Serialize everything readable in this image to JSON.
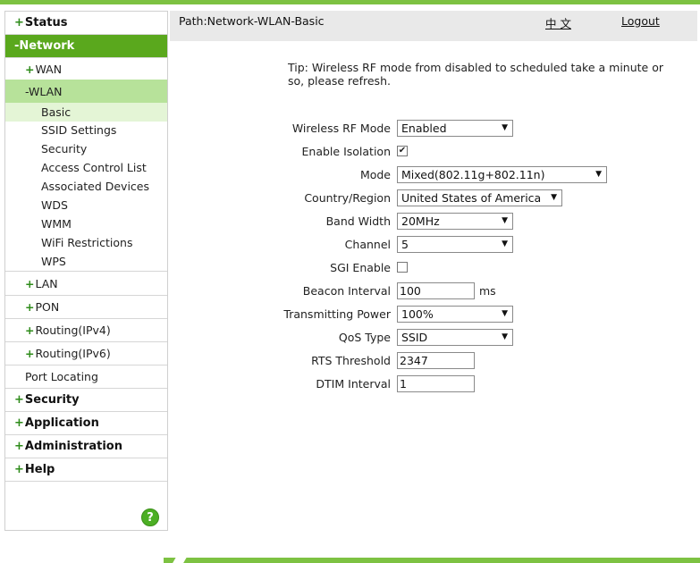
{
  "sidebar": {
    "status": "Status",
    "network": "-Network",
    "wan": "WAN",
    "wlan": "-WLAN",
    "wlan_items": [
      "Basic",
      "SSID Settings",
      "Security",
      "Access Control List",
      "Associated Devices",
      "WDS",
      "WMM",
      "WiFi Restrictions",
      "WPS"
    ],
    "lan": "LAN",
    "pon": "PON",
    "routing_ipv4": "Routing(IPv4)",
    "routing_ipv6": "Routing(IPv6)",
    "port_locating": "Port Locating",
    "security": "Security",
    "application": "Application",
    "administration": "Administration",
    "help": "Help",
    "help_icon": "?"
  },
  "header": {
    "breadcrumb": "Path:Network-WLAN-Basic",
    "language": "中 文",
    "logout": "Logout"
  },
  "tip": "Tip: Wireless RF mode from disabled to scheduled take a minute or so, please refresh.",
  "form": {
    "rf_mode": {
      "label": "Wireless RF Mode",
      "value": "Enabled"
    },
    "isolation": {
      "label": "Enable Isolation",
      "checked": true
    },
    "mode": {
      "label": "Mode",
      "value": "Mixed(802.11g+802.11n)"
    },
    "country": {
      "label": "Country/Region",
      "value": "United States of America"
    },
    "bandwidth": {
      "label": "Band Width",
      "value": "20MHz"
    },
    "channel": {
      "label": "Channel",
      "value": "5"
    },
    "sgi": {
      "label": "SGI Enable",
      "checked": false
    },
    "beacon": {
      "label": "Beacon Interval",
      "value": "100",
      "unit": "ms"
    },
    "tx_power": {
      "label": "Transmitting Power",
      "value": "100%"
    },
    "qos": {
      "label": "QoS Type",
      "value": "SSID"
    },
    "rts": {
      "label": "RTS Threshold",
      "value": "2347"
    },
    "dtim": {
      "label": "DTIM Interval",
      "value": "1"
    }
  },
  "colors": {
    "accent": "#5aa81d",
    "accent_light": "#b7e29a",
    "highlight": "#e4f5d6",
    "bar": "#7dc242"
  },
  "icons": {
    "dropdown": "triangle-down-icon",
    "help": "help-circle-icon"
  }
}
